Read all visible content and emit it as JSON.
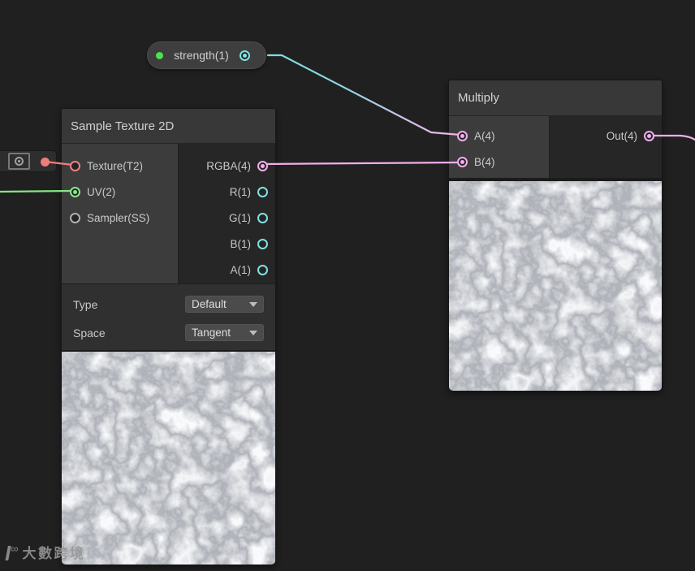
{
  "canvas": {
    "background": "#202020"
  },
  "strength_pill": {
    "label": "strength(1)"
  },
  "offscreen_node": {
    "icon": "target-preview-toggle",
    "port_type": "texture2d"
  },
  "sample_texture_node": {
    "title": "Sample Texture 2D",
    "inputs": [
      {
        "label": "Texture(T2)",
        "type": "texture2d",
        "connected": true
      },
      {
        "label": "UV(2)",
        "type": "vector2",
        "connected": true
      },
      {
        "label": "Sampler(SS)",
        "type": "sampler",
        "connected": false
      }
    ],
    "outputs": [
      {
        "label": "RGBA(4)",
        "type": "vector4",
        "connected": true
      },
      {
        "label": "R(1)",
        "type": "vector1",
        "connected": false
      },
      {
        "label": "G(1)",
        "type": "vector1",
        "connected": false
      },
      {
        "label": "B(1)",
        "type": "vector1",
        "connected": false
      },
      {
        "label": "A(1)",
        "type": "vector1",
        "connected": false
      }
    ],
    "controls": [
      {
        "label": "Type",
        "value": "Default"
      },
      {
        "label": "Space",
        "value": "Tangent"
      }
    ]
  },
  "multiply_node": {
    "title": "Multiply",
    "inputs": [
      {
        "label": "A(4)",
        "type": "vector4",
        "connected": true
      },
      {
        "label": "B(4)",
        "type": "vector4",
        "connected": true
      }
    ],
    "outputs": [
      {
        "label": "Out(4)",
        "type": "vector4",
        "connected": true
      }
    ]
  },
  "watermark": {
    "logo_glyph": "Ɩ",
    "logo_sup": "∞",
    "text": "大數跨境"
  },
  "colors": {
    "vector1_cyan": "#7fe3e1",
    "vector2_green": "#88e788",
    "vector4_pink": "#f4aeec",
    "texture2d_red": "#ef8080",
    "sampler_gray": "#b0b0b0",
    "property_dot_green": "#4ee04e",
    "node_header": "#383838",
    "node_input_column": "#3c3c3c",
    "node_output_column": "#262626",
    "canvas_background": "#202020"
  }
}
